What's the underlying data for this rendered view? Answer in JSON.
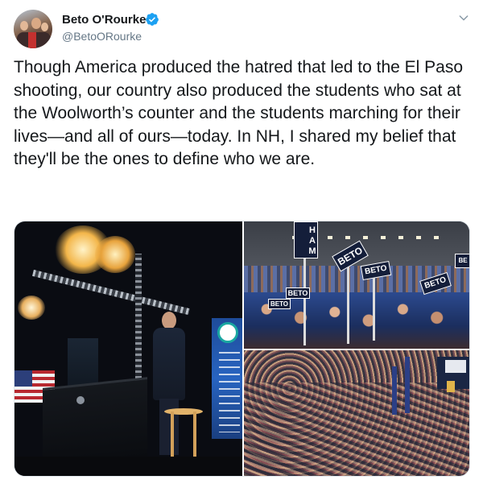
{
  "tweet": {
    "user_name": "Beto O'Rourke",
    "handle": "@BetoORourke",
    "verified": true,
    "text": "Though America produced the hatred that led to the El Paso shooting, our country also produced the students who sat at the Woolworth’s counter and the students marching for their lives—and all of ours—today. In NH, I shared my belief that they'll be the ones to define who we are."
  },
  "icons": {
    "verified": "verified-badge-icon",
    "menu": "chevron-down-icon"
  },
  "media": {
    "signs": {
      "vertical": "HAM",
      "sign_a": "BETO",
      "sign_b": "BETO",
      "sign_c": "BETO",
      "sign_d": "BETO",
      "sign_e": "BETO",
      "sign_f": "BE"
    }
  },
  "colors": {
    "text": "#14171a",
    "secondary": "#657786",
    "verified": "#1da1f2",
    "border": "#e1e8ed"
  }
}
